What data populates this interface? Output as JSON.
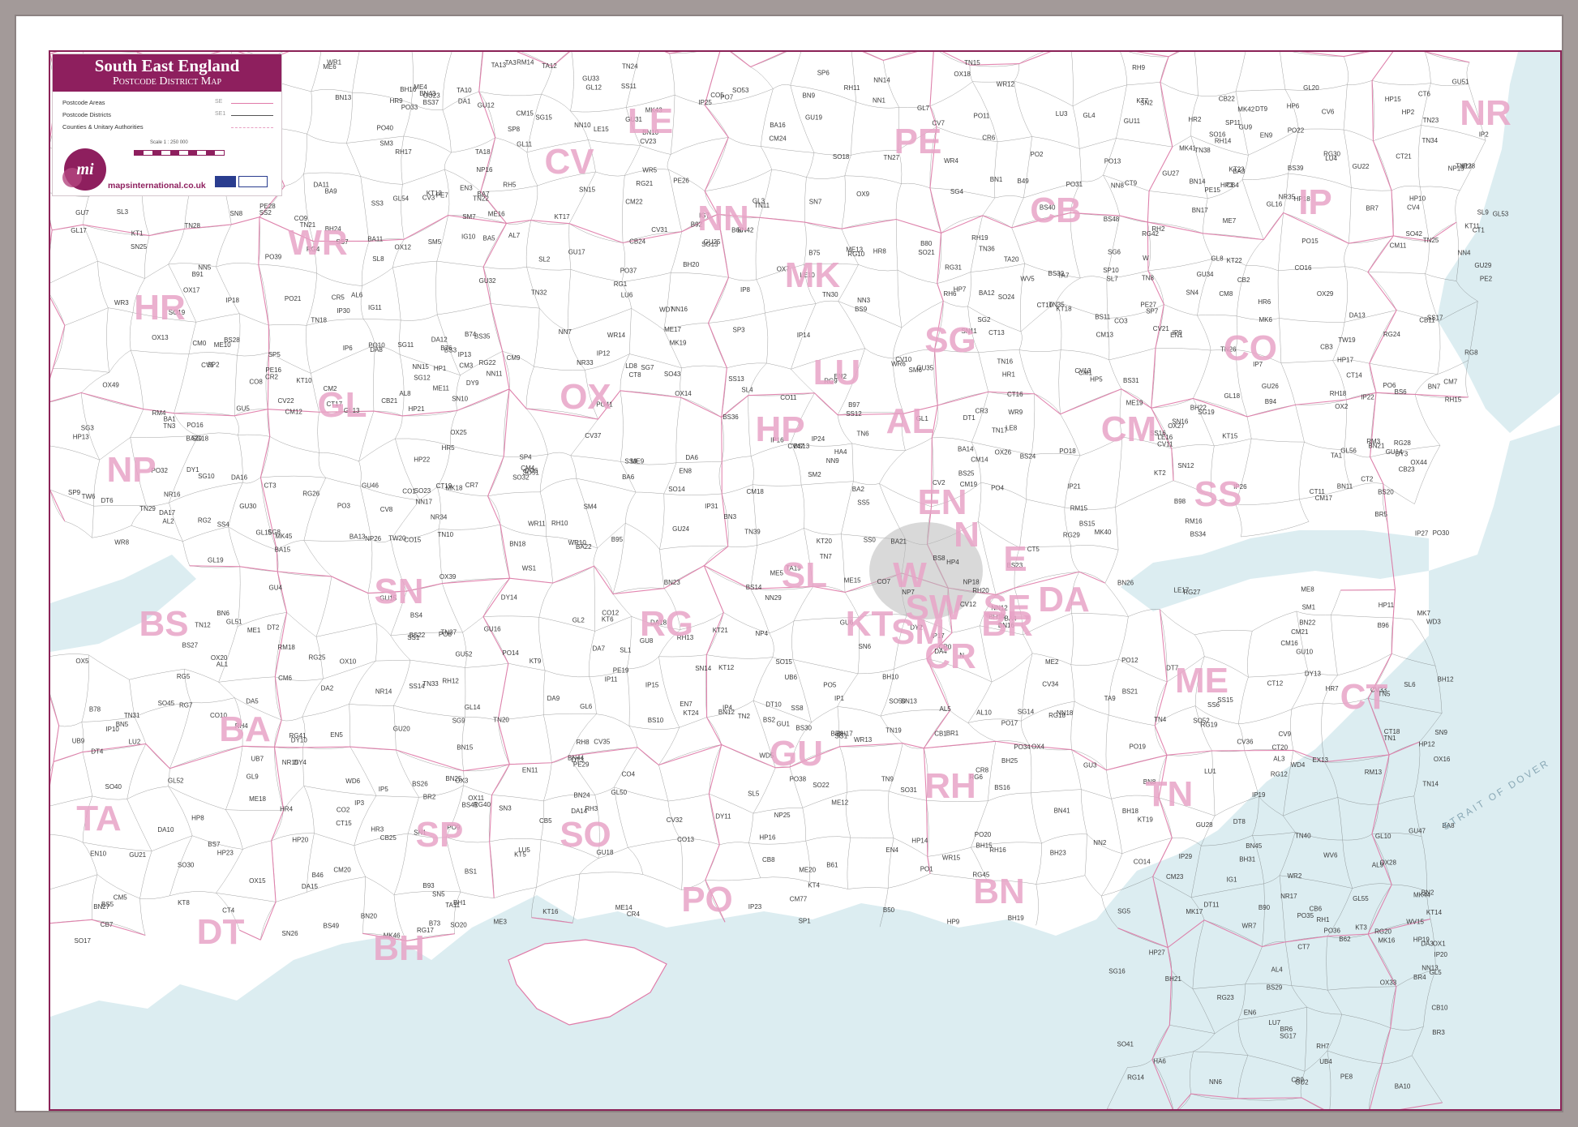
{
  "title": {
    "main": "South East England",
    "sub": "Postcode District Map"
  },
  "legend": {
    "items": [
      {
        "label": "Postcode Areas",
        "sample": "SE",
        "line_color": "#e07aa8"
      },
      {
        "label": "Postcode Districts",
        "sample": "SE1",
        "line_color": "#555555"
      },
      {
        "label": "Counties & Unitary Authorities",
        "sample": "",
        "line_color": "#e8a0c2"
      }
    ],
    "scale": "Scale 1 : 250 000",
    "website": "mapsinternational.co.uk",
    "logo_text": "mi"
  },
  "colors": {
    "frame": "#a39a99",
    "title_band": "#8e1f5e",
    "sea": "#dcedf1",
    "area_boundary": "#e07aa8",
    "district_boundary": "#555555",
    "area_label": "#e7a3c7"
  },
  "strait_label": "STRAIT OF DOVER",
  "area_labels": [
    "LE",
    "PE",
    "NR",
    "IP",
    "CB",
    "MK",
    "NN",
    "CV",
    "WR",
    "HR",
    "GL",
    "OX",
    "SG",
    "AL",
    "HP",
    "LU",
    "CO",
    "CM",
    "SS",
    "NP",
    "BS",
    "SN",
    "RG",
    "SL",
    "GU",
    "KT",
    "SM",
    "CR",
    "BR",
    "DA",
    "ME",
    "CT",
    "TN",
    "RH",
    "BN",
    "PO",
    "SO",
    "SP",
    "BH",
    "DT",
    "TA",
    "BA",
    "EN",
    "N",
    "E",
    "W",
    "SW",
    "SE"
  ],
  "district_labels": [
    "LE10",
    "LE8",
    "LE16",
    "LE15",
    "LE17",
    "PE2",
    "PE7",
    "PE8",
    "PE15",
    "PE16",
    "PE26",
    "PE28",
    "PE29",
    "PE27",
    "PE19",
    "NR14",
    "NR15",
    "NR17",
    "NR16",
    "NR35",
    "NR34",
    "NR33",
    "IP26",
    "IP27",
    "IP24",
    "IP25",
    "IP31",
    "IP28",
    "IP22",
    "IP23",
    "IP21",
    "IP20",
    "IP19",
    "IP18",
    "IP17",
    "IP14",
    "IP16",
    "IP12",
    "IP13",
    "IP15",
    "IP8",
    "IP7",
    "IP6",
    "IP5",
    "IP4",
    "IP3",
    "IP2",
    "IP1",
    "IP9",
    "IP10",
    "IP11",
    "IP30",
    "IP29",
    "CB9",
    "CB8",
    "CB7",
    "CB6",
    "CB25",
    "CB24",
    "CB23",
    "CB22",
    "CB21",
    "CB11",
    "CB10",
    "CB1",
    "CB2",
    "CB3",
    "CB4",
    "CB5",
    "NN17",
    "NN14",
    "NN18",
    "NN16",
    "NN15",
    "NN9",
    "NN8",
    "NN10",
    "NN29",
    "NN6",
    "NN7",
    "NN5",
    "NN4",
    "NN3",
    "NN2",
    "NN1",
    "NN11",
    "NN12",
    "NN13",
    "MK44",
    "MK46",
    "MK43",
    "MK41",
    "MK42",
    "MK45",
    "MK40",
    "MK19",
    "MK18",
    "MK17",
    "MK16",
    "MK6",
    "MK7",
    "CV13",
    "CV9",
    "CV11",
    "CV10",
    "CV12",
    "CV7",
    "CV6",
    "CV5",
    "CV3",
    "CV4",
    "CV2",
    "CV8",
    "CV32",
    "CV34",
    "CV31",
    "CV33",
    "CV35",
    "CV36",
    "CV37",
    "CV47",
    "CV21",
    "CV22",
    "CV23",
    "WR6",
    "WR5",
    "WR4",
    "WR3",
    "WR2",
    "WR1",
    "WR7",
    "WR8",
    "WR9",
    "WR10",
    "WR11",
    "WR12",
    "WR13",
    "WR14",
    "WR15",
    "HR1",
    "HR2",
    "HR3",
    "HR4",
    "HR5",
    "HR6",
    "HR7",
    "HR8",
    "HR9",
    "GL1",
    "GL2",
    "GL3",
    "GL4",
    "GL5",
    "GL6",
    "GL7",
    "GL8",
    "GL9",
    "GL10",
    "GL11",
    "GL12",
    "GL13",
    "GL14",
    "GL15",
    "GL16",
    "GL17",
    "GL18",
    "GL19",
    "GL20",
    "GL50",
    "GL51",
    "GL52",
    "GL53",
    "GL54",
    "GL55",
    "GL56",
    "OX1",
    "OX2",
    "OX3",
    "OX4",
    "OX5",
    "OX7",
    "OX9",
    "OX10",
    "OX11",
    "OX12",
    "OX13",
    "OX14",
    "OX15",
    "OX16",
    "OX17",
    "OX18",
    "OX20",
    "OX25",
    "OX26",
    "OX27",
    "OX28",
    "OX29",
    "OX33",
    "OX39",
    "OX44",
    "OX49",
    "SG1",
    "SG2",
    "SG3",
    "SG4",
    "SG5",
    "SG6",
    "SG7",
    "SG8",
    "SG9",
    "SG10",
    "SG11",
    "SG12",
    "SG13",
    "SG14",
    "SG15",
    "SG16",
    "SG17",
    "SG18",
    "SG19",
    "AL1",
    "AL2",
    "AL3",
    "AL4",
    "AL5",
    "AL6",
    "AL7",
    "AL8",
    "AL9",
    "AL10",
    "HP1",
    "HP2",
    "HP3",
    "HP4",
    "HP5",
    "HP6",
    "HP7",
    "HP8",
    "HP9",
    "HP10",
    "HP11",
    "HP12",
    "HP13",
    "HP14",
    "HP15",
    "HP16",
    "HP17",
    "HP18",
    "HP19",
    "HP20",
    "HP21",
    "HP22",
    "HP23",
    "HP27",
    "LU1",
    "LU2",
    "LU3",
    "LU4",
    "LU5",
    "LU6",
    "LU7",
    "CO1",
    "CO2",
    "CO3",
    "CO4",
    "CO5",
    "CO6",
    "CO7",
    "CO8",
    "CO9",
    "CO10",
    "CO11",
    "CO12",
    "CO13",
    "CO14",
    "CO15",
    "CO16",
    "CM0",
    "CM1",
    "CM2",
    "CM3",
    "CM4",
    "CM5",
    "CM6",
    "CM7",
    "CM8",
    "CM9",
    "CM11",
    "CM12",
    "CM13",
    "CM14",
    "CM15",
    "CM16",
    "CM17",
    "CM18",
    "CM19",
    "CM20",
    "CM21",
    "CM22",
    "CM23",
    "CM24",
    "CM77",
    "SS0",
    "SS1",
    "SS2",
    "SS3",
    "SS4",
    "SS5",
    "SS6",
    "SS7",
    "SS8",
    "SS9",
    "SS11",
    "SS12",
    "SS13",
    "SS14",
    "SS15",
    "SS16",
    "SS17",
    "NP4",
    "NP7",
    "NP15",
    "NP16",
    "NP18",
    "NP25",
    "NP26",
    "BS1",
    "BS2",
    "BS3",
    "BS4",
    "BS5",
    "BS6",
    "BS7",
    "BS8",
    "BS9",
    "BS10",
    "BS11",
    "BS13",
    "BS14",
    "BS15",
    "BS16",
    "BS20",
    "BS21",
    "BS22",
    "BS23",
    "BS24",
    "BS25",
    "BS26",
    "BS27",
    "BS28",
    "BS29",
    "BS30",
    "BS31",
    "BS32",
    "BS34",
    "BS35",
    "BS36",
    "BS37",
    "BS39",
    "BS40",
    "BS41",
    "BS48",
    "BS49",
    "SN1",
    "SN2",
    "SN3",
    "SN4",
    "SN5",
    "SN6",
    "SN7",
    "SN8",
    "SN9",
    "SN10",
    "SN11",
    "SN12",
    "SN13",
    "SN14",
    "SN15",
    "SN16",
    "SN25",
    "SN26",
    "RG1",
    "RG2",
    "RG4",
    "RG5",
    "RG6",
    "RG7",
    "RG8",
    "RG9",
    "RG10",
    "RG12",
    "RG14",
    "RG17",
    "RG18",
    "RG19",
    "RG20",
    "RG21",
    "RG22",
    "RG23",
    "RG24",
    "RG25",
    "RG26",
    "RG27",
    "RG28",
    "RG29",
    "RG30",
    "RG31",
    "RG40",
    "RG41",
    "RG42",
    "RG45",
    "SL1",
    "SL2",
    "SL3",
    "SL4",
    "SL5",
    "SL6",
    "SL7",
    "SL8",
    "SL9",
    "GU1",
    "GU2",
    "GU3",
    "GU4",
    "GU5",
    "GU6",
    "GU7",
    "GU8",
    "GU9",
    "GU10",
    "GU11",
    "GU12",
    "GU14",
    "GU15",
    "GU16",
    "GU17",
    "GU18",
    "GU19",
    "GU20",
    "GU21",
    "GU22",
    "GU23",
    "GU24",
    "GU25",
    "GU26",
    "GU27",
    "GU28",
    "GU29",
    "GU30",
    "GU31",
    "GU32",
    "GU33",
    "GU34",
    "GU35",
    "GU46",
    "GU47",
    "GU51",
    "GU52",
    "KT1",
    "KT2",
    "KT3",
    "KT4",
    "KT5",
    "KT6",
    "KT7",
    "KT8",
    "KT9",
    "KT10",
    "KT11",
    "KT12",
    "KT13",
    "KT14",
    "KT15",
    "KT16",
    "KT17",
    "KT18",
    "KT19",
    "KT20",
    "KT21",
    "KT22",
    "KT23",
    "KT24",
    "SM1",
    "SM2",
    "SM3",
    "SM4",
    "SM5",
    "SM6",
    "SM7",
    "CR0",
    "CR2",
    "CR3",
    "CR4",
    "CR5",
    "CR6",
    "CR7",
    "CR8",
    "BR1",
    "BR2",
    "BR3",
    "BR4",
    "BR5",
    "BR6",
    "BR7",
    "BR8",
    "DA1",
    "DA2",
    "DA3",
    "DA4",
    "DA5",
    "DA6",
    "DA7",
    "DA8",
    "DA9",
    "DA10",
    "DA11",
    "DA12",
    "DA13",
    "DA14",
    "DA15",
    "DA16",
    "DA17",
    "DA18",
    "ME1",
    "ME2",
    "ME3",
    "ME4",
    "ME5",
    "ME6",
    "ME7",
    "ME8",
    "ME9",
    "ME10",
    "ME11",
    "ME12",
    "ME13",
    "ME14",
    "ME15",
    "ME16",
    "ME17",
    "ME18",
    "ME19",
    "ME20",
    "CT1",
    "CT2",
    "CT3",
    "CT4",
    "CT5",
    "CT6",
    "CT7",
    "CT8",
    "CT9",
    "CT10",
    "CT11",
    "CT12",
    "CT13",
    "CT14",
    "CT15",
    "CT16",
    "CT17",
    "CT18",
    "CT19",
    "CT20",
    "CT21",
    "TN1",
    "TN2",
    "TN3",
    "TN4",
    "TN5",
    "TN6",
    "TN7",
    "TN8",
    "TN9",
    "TN10",
    "TN11",
    "TN12",
    "TN13",
    "TN14",
    "TN15",
    "TN16",
    "TN17",
    "TN18",
    "TN19",
    "TN20",
    "TN21",
    "TN22",
    "TN23",
    "TN24",
    "TN25",
    "TN26",
    "TN27",
    "TN28",
    "TN29",
    "TN30",
    "TN31",
    "TN32",
    "TN33",
    "TN34",
    "TN35",
    "TN36",
    "TN37",
    "TN38",
    "TN39",
    "TN40",
    "RH1",
    "RH2",
    "RH3",
    "RH4",
    "RH5",
    "RH6",
    "RH7",
    "RH8",
    "RH9",
    "RH10",
    "RH11",
    "RH12",
    "RH13",
    "RH14",
    "RH15",
    "RH16",
    "RH17",
    "RH18",
    "RH19",
    "RH20",
    "BN1",
    "BN2",
    "BN3",
    "BN5",
    "BN6",
    "BN7",
    "BN8",
    "BN9",
    "BN10",
    "BN11",
    "BN12",
    "BN13",
    "BN14",
    "BN15",
    "BN16",
    "BN17",
    "BN18",
    "BN20",
    "BN21",
    "BN22",
    "BN23",
    "BN24",
    "BN25",
    "BN26",
    "BN27",
    "BN41",
    "BN42",
    "BN43",
    "BN44",
    "BN45",
    "PO1",
    "PO2",
    "PO3",
    "PO4",
    "PO5",
    "PO6",
    "PO7",
    "PO8",
    "PO9",
    "PO10",
    "PO11",
    "PO12",
    "PO13",
    "PO14",
    "PO15",
    "PO16",
    "PO17",
    "PO18",
    "PO19",
    "PO20",
    "PO21",
    "PO22",
    "PO30",
    "PO31",
    "PO32",
    "PO33",
    "PO34",
    "PO35",
    "PO36",
    "PO37",
    "PO38",
    "PO39",
    "PO40",
    "PO41",
    "SO14",
    "SO15",
    "SO16",
    "SO17",
    "SO18",
    "SO19",
    "SO20",
    "SO21",
    "SO22",
    "SO23",
    "SO24",
    "SO30",
    "SO31",
    "SO32",
    "SO40",
    "SO41",
    "SO42",
    "SO43",
    "SO45",
    "SO50",
    "SO51",
    "SO52",
    "SO53",
    "SP1",
    "SP2",
    "SP3",
    "SP4",
    "SP5",
    "SP6",
    "SP7",
    "SP8",
    "SP9",
    "SP10",
    "SP11",
    "BH1",
    "BH10",
    "BH12",
    "BH14",
    "BH15",
    "BH16",
    "BH17",
    "BH18",
    "BH19",
    "BH20",
    "BH21",
    "BH22",
    "BH23",
    "BH24",
    "BH25",
    "BH31",
    "DT1",
    "DT2",
    "DT3",
    "DT4",
    "DT6",
    "DT7",
    "DT8",
    "DT9",
    "DT10",
    "DT11",
    "TA1",
    "TA3",
    "TA7",
    "TA9",
    "TA10",
    "TA11",
    "TA12",
    "TA13",
    "TA18",
    "TA19",
    "TA20",
    "BA1",
    "BA2",
    "BA3",
    "BA4",
    "BA5",
    "BA6",
    "BA7",
    "BA8",
    "BA9",
    "BA10",
    "BA11",
    "BA12",
    "BA13",
    "BA14",
    "BA15",
    "BA16",
    "BA20",
    "BA21",
    "BA22",
    "EN1",
    "EN2",
    "EN3",
    "EN4",
    "EN5",
    "EN6",
    "EN7",
    "EN8",
    "EN9",
    "EN10",
    "EN11",
    "WD3",
    "WD4",
    "WD5",
    "WD6",
    "WD7",
    "IG1",
    "IG7",
    "IG10",
    "IG11",
    "RM3",
    "RM4",
    "RM13",
    "RM14",
    "RM15",
    "RM16",
    "RM18",
    "UB4",
    "UB6",
    "UB7",
    "UB9",
    "HA4",
    "HA6",
    "TW6",
    "TW19",
    "TW20",
    "B46",
    "B49",
    "B50",
    "B60",
    "B61",
    "B62",
    "B73",
    "B74",
    "B75",
    "B76",
    "B78",
    "B80",
    "B90",
    "B91",
    "B92",
    "B93",
    "B94",
    "B95",
    "B96",
    "B97",
    "B98",
    "DY1",
    "DY2",
    "DY3",
    "DY4",
    "DY9",
    "DY10",
    "DY11",
    "DY13",
    "DY14",
    "WV5",
    "WV6",
    "WV15",
    "WS1",
    "EX13",
    "LD8",
    "N",
    "W"
  ]
}
